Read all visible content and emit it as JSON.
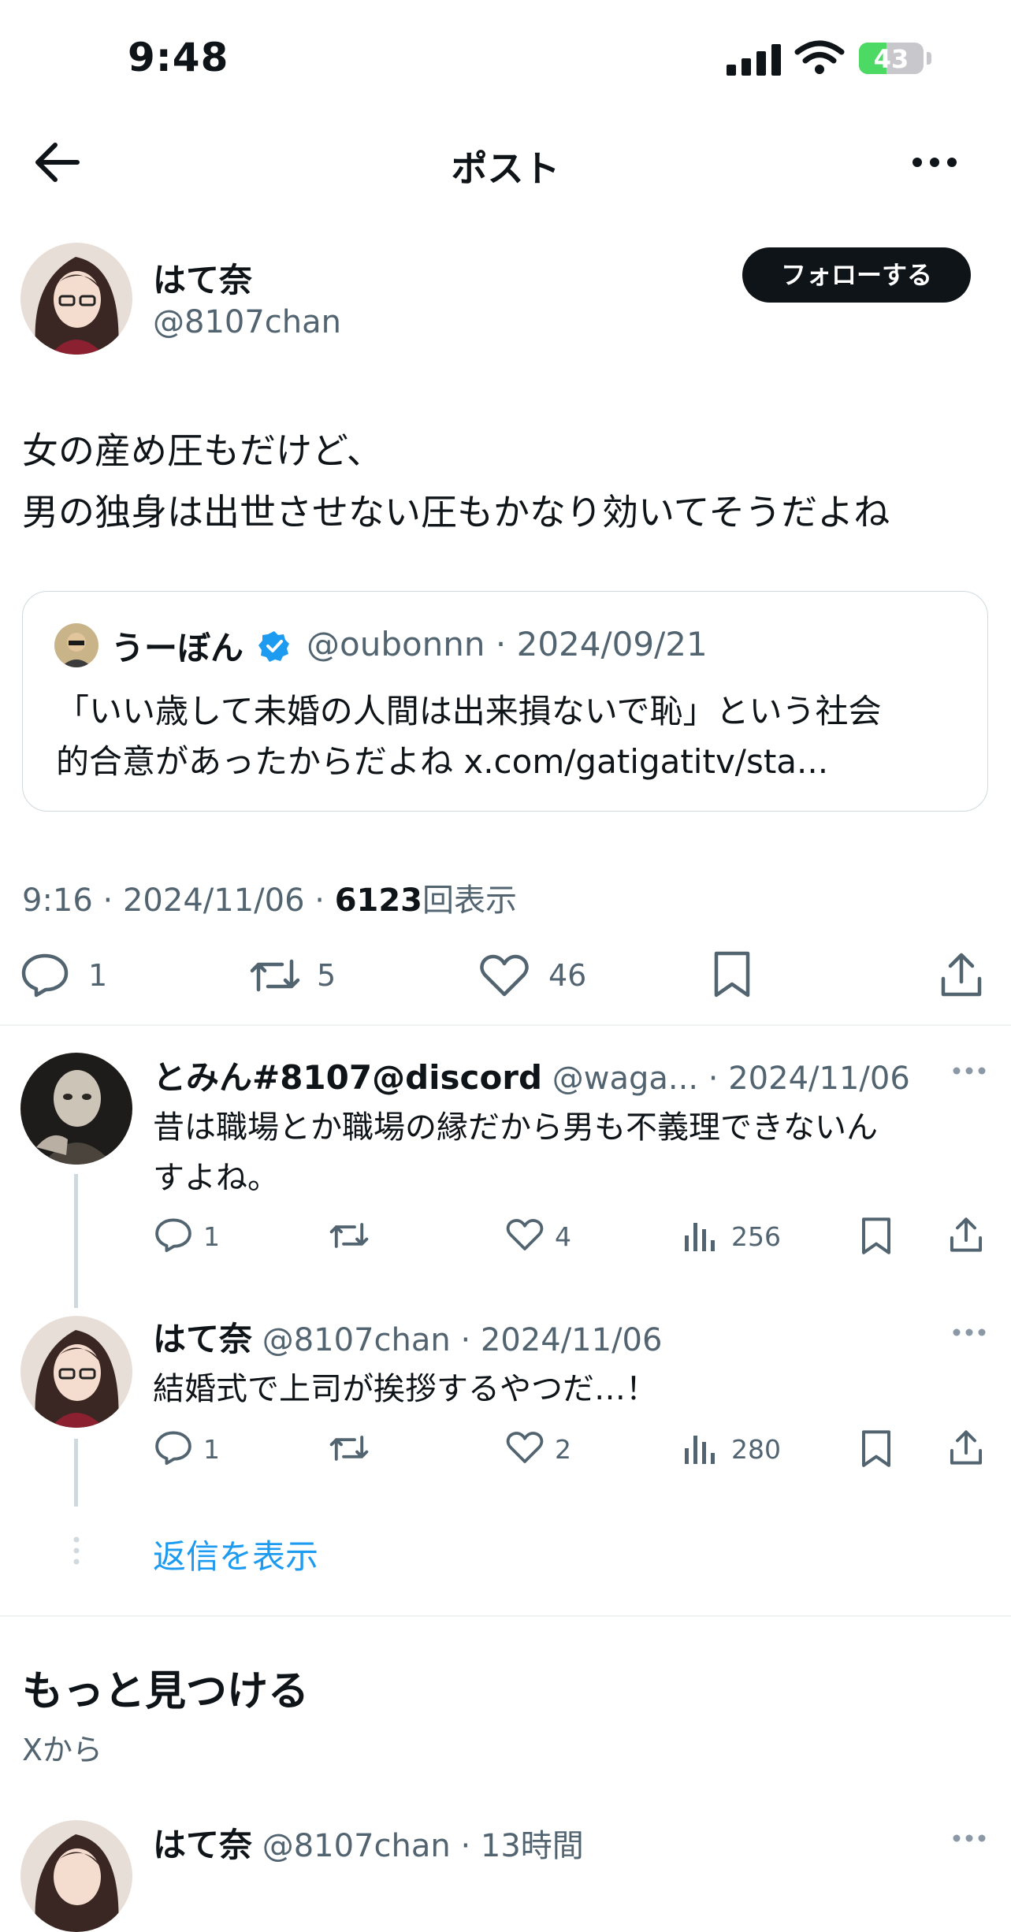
{
  "status_bar": {
    "time": "9:48",
    "battery": "43"
  },
  "nav": {
    "title": "ポスト"
  },
  "post": {
    "author_name": "はて奈",
    "author_handle": "@8107chan",
    "follow_label": "フォローする",
    "text_lines": [
      "女の産め圧もだけど、",
      "男の独身は出世させない圧もかなり効いてそうだよね"
    ],
    "quote": {
      "name": "うーぼん",
      "handle": "@oubonnn",
      "date": "2024/09/21",
      "text_lines": [
        "「いい歳して未婚の人間は出来損ないで恥」という社会",
        "的合意があったからだよね x.com/gatigatitv/sta..."
      ]
    },
    "meta": {
      "time": "9:16",
      "date": "2024/11/06",
      "views": "6123",
      "views_label": "回表示"
    },
    "actions": {
      "replies": "1",
      "reposts": "5",
      "likes": "46"
    }
  },
  "replies": [
    {
      "name": "とみん#8107@discord",
      "handle": "@waga...",
      "date": "2024/11/06",
      "text_lines": [
        "昔は職場とか職場の縁だから男も不義理できないん",
        "すよね。"
      ],
      "replies": "1",
      "likes": "4",
      "views": "256"
    },
    {
      "name": "はて奈",
      "handle": "@8107chan",
      "date": "2024/11/06",
      "text_lines": [
        "結婚式で上司が挨拶するやつだ…！"
      ],
      "replies": "1",
      "likes": "2",
      "views": "280"
    }
  ],
  "show_replies_label": "返信を表示",
  "discover": {
    "title": "もっと見つける",
    "subtitle": "Xから",
    "first": {
      "name": "はて奈",
      "handle": "@8107chan",
      "time": "13時間"
    }
  },
  "colors": {
    "accent": "#1d9bf0",
    "text": "#0f1419",
    "muted": "#536471",
    "border": "#cfd9de"
  }
}
